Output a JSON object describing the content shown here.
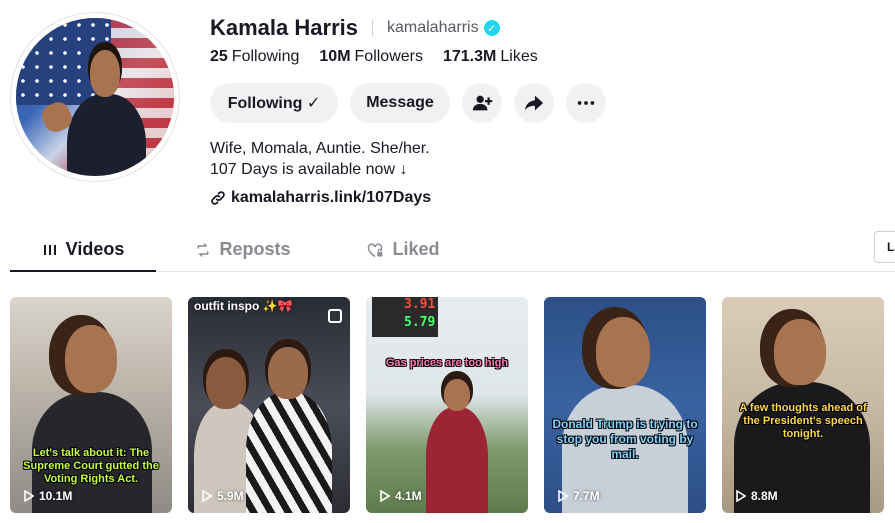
{
  "profile": {
    "name": "Kamala Harris",
    "handle": "kamalaharris",
    "verified_icon": "verified-badge-icon",
    "stats": [
      {
        "value": "25",
        "label": "Following"
      },
      {
        "value": "10M",
        "label": "Followers"
      },
      {
        "value": "171.3M",
        "label": "Likes"
      }
    ],
    "buttons": {
      "following": "Following ✓",
      "message": "Message"
    },
    "icon_buttons": [
      "add-friend-icon",
      "share-icon",
      "more-icon"
    ],
    "bio_line1": "Wife, Momala, Auntie. She/her.",
    "bio_line2": "107 Days is available now ↓",
    "link": "kamalaharris.link/107Days"
  },
  "tabs": [
    {
      "label": "Videos",
      "icon": "grid-icon",
      "active": true
    },
    {
      "label": "Reposts",
      "icon": "repost-icon",
      "active": false
    },
    {
      "label": "Liked",
      "icon": "heart-lock-icon",
      "active": false
    }
  ],
  "lang_chip": "La",
  "videos": [
    {
      "views": "10.1M",
      "caption": "Let's talk about it: The Supreme Court gutted the Voting Rights Act.",
      "caption_color": "#c6ff3d"
    },
    {
      "views": "5.9M",
      "top_label": "outfit inspo ✨🎀",
      "multi": true
    },
    {
      "views": "4.1M",
      "caption": "Gas prices are too high",
      "caption_color": "#ff7ab6",
      "price1": "3.91",
      "price2": "5.79"
    },
    {
      "views": "7.7M",
      "caption": "Donald Trump is trying to stop you from voting by mail.",
      "caption_color": "#7fd3ff"
    },
    {
      "views": "8.8M",
      "caption": "A few thoughts ahead of the President's speech tonight.",
      "caption_color": "#ffd84d"
    }
  ]
}
